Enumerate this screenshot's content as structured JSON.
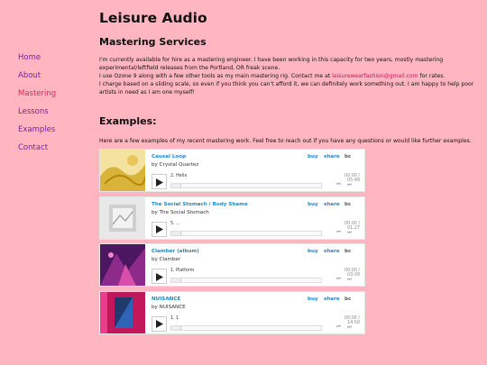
{
  "site": {
    "title": "Leisure Audio"
  },
  "nav": [
    {
      "label": "Home"
    },
    {
      "label": "About"
    },
    {
      "label": "Mastering"
    },
    {
      "label": "Lessons"
    },
    {
      "label": "Examples"
    },
    {
      "label": "Contact"
    }
  ],
  "nav_active": "Mastering",
  "colors": {
    "background": "#ffb6c1",
    "nav_link": "#7b1fa2",
    "nav_active": "#e0245e",
    "email_link": "#c2185b",
    "player_link": "#1a8acb"
  },
  "mastering": {
    "heading": "Mastering Services",
    "p1": "I'm currently available for hire as a mastering engineer. I have been working in this capacity for two years, mostly mastering experimental/leftfield releases from the Portland, OR freak scene.",
    "p2_before": "I use Ozone 9 along with a few other tools as my main mastering rig. Contact me at ",
    "email": "leisurewearfashion@gmail.com",
    "p2_after": " for rates.",
    "p3": "I charge based on a sliding scale, so even if you think you can't afford it, we can definitely work something out. I am happy to help poor artists in need as I am one myself!"
  },
  "examples": {
    "heading": "Examples:",
    "intro": "Here are a few examples of my recent mastering work. Feel free to reach out if you have any questions or would like further examples."
  },
  "players": [
    {
      "album": "Causal Loop",
      "by": "by Crystal Quartez",
      "buy": "buy",
      "share": "share",
      "logo": "bc",
      "track": "2.  Helix",
      "time": "00:00 / 05:49",
      "art_icon": "album-art-causal-loop-icon"
    },
    {
      "album": "The Social Stomach / Body Shame",
      "by": "by The Social Stomach",
      "buy": "buy",
      "share": "share",
      "logo": "bc",
      "track": "5.  ...",
      "time": "00:00 / 01:27",
      "art_icon": "album-art-social-stomach-icon"
    },
    {
      "album": "Clamber (album)",
      "by": "by Clamber",
      "buy": "buy",
      "share": "share",
      "logo": "bc",
      "track": "1.  Platform",
      "time": "00:00 / 03:09",
      "art_icon": "album-art-clamber-icon"
    },
    {
      "album": "NUISANCE",
      "by": "by NUISANCE",
      "buy": "buy",
      "share": "share",
      "logo": "bc",
      "track": "1.  1",
      "time": "00:00 / 14:50",
      "art_icon": "album-art-nuisance-icon"
    }
  ]
}
